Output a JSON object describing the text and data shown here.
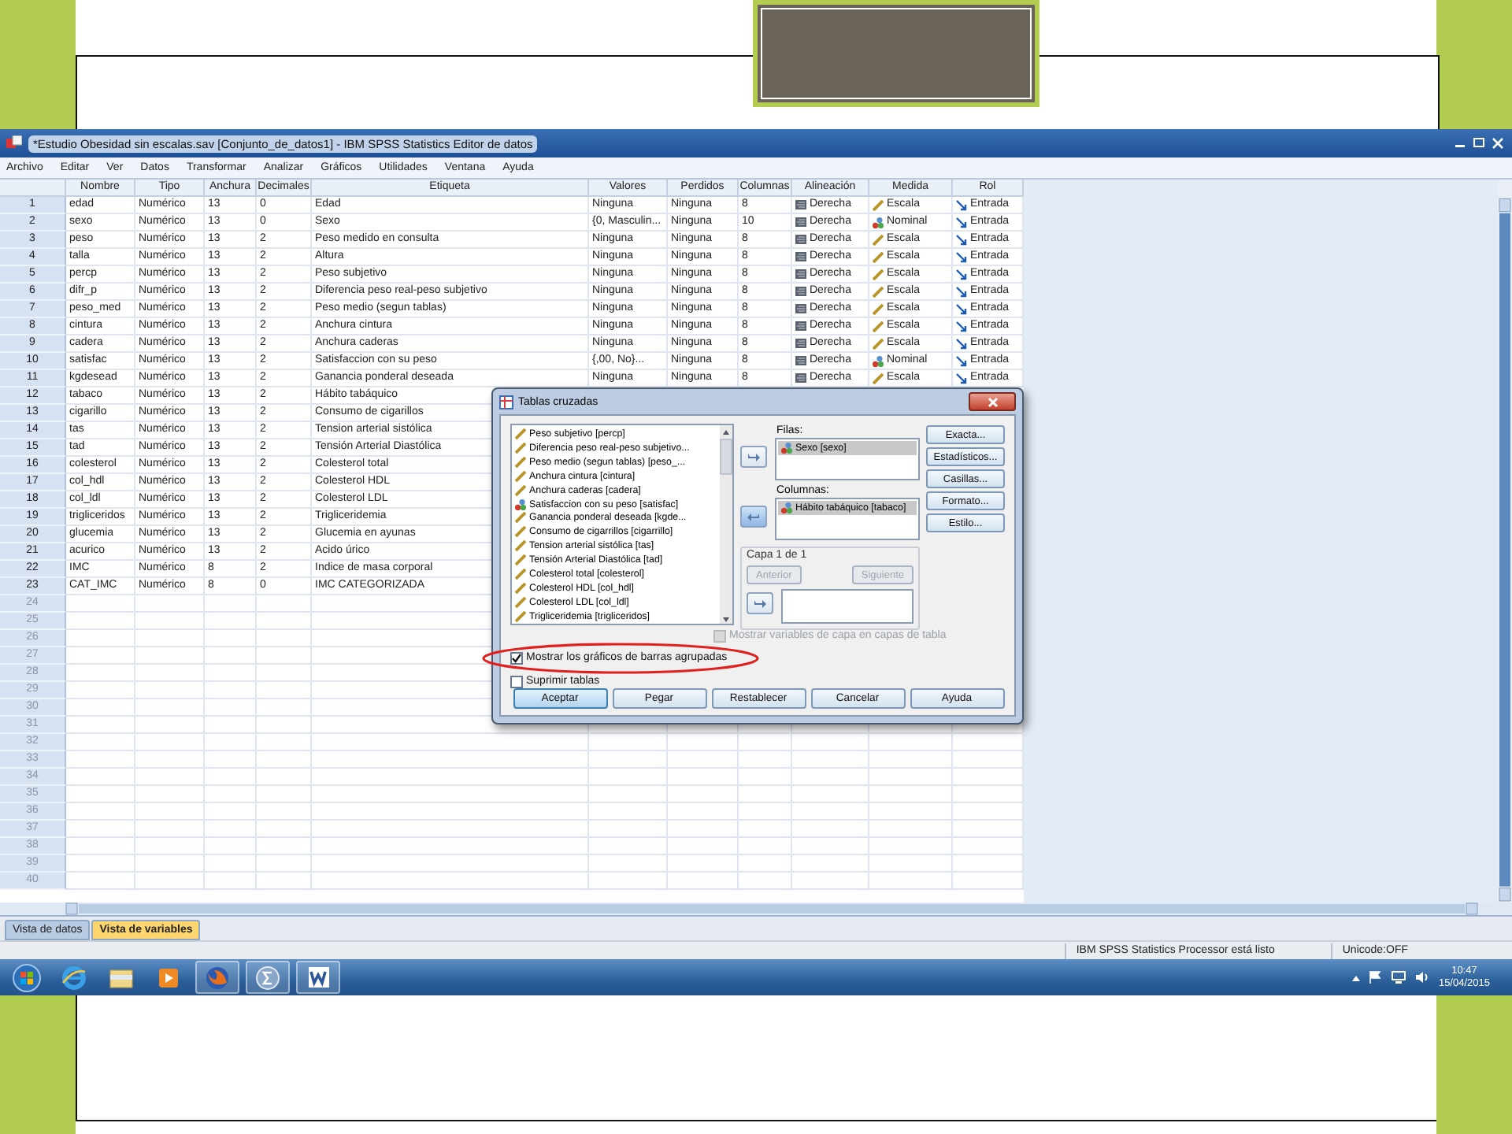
{
  "window": {
    "title": "*Estudio Obesidad sin escalas.sav [Conjunto_de_datos1] - IBM SPSS Statistics Editor de datos"
  },
  "menu": [
    "Archivo",
    "Editar",
    "Ver",
    "Datos",
    "Transformar",
    "Analizar",
    "Gráficos",
    "Utilidades",
    "Ventana",
    "Ayuda"
  ],
  "table": {
    "columns": [
      "Nombre",
      "Tipo",
      "Anchura",
      "Decimales",
      "Etiqueta",
      "Valores",
      "Perdidos",
      "Columnas",
      "Alineación",
      "Medida",
      "Rol"
    ],
    "rows": [
      {
        "number": "1",
        "cells": [
          "edad",
          "Numérico",
          "13",
          "0",
          "Edad",
          "Ninguna",
          "Ninguna",
          "8",
          "Derecha",
          "Escala",
          "Entrada"
        ],
        "kind": "scale"
      },
      {
        "number": "2",
        "cells": [
          "sexo",
          "Numérico",
          "13",
          "0",
          "Sexo",
          "{0, Masculin...",
          "Ninguna",
          "10",
          "Derecha",
          "Nominal",
          "Entrada"
        ],
        "kind": "nominal"
      },
      {
        "number": "3",
        "cells": [
          "peso",
          "Numérico",
          "13",
          "2",
          "Peso medido en consulta",
          "Ninguna",
          "Ninguna",
          "8",
          "Derecha",
          "Escala",
          "Entrada"
        ],
        "kind": "scale"
      },
      {
        "number": "4",
        "cells": [
          "talla",
          "Numérico",
          "13",
          "2",
          "Altura",
          "Ninguna",
          "Ninguna",
          "8",
          "Derecha",
          "Escala",
          "Entrada"
        ],
        "kind": "scale"
      },
      {
        "number": "5",
        "cells": [
          "percp",
          "Numérico",
          "13",
          "2",
          "Peso subjetivo",
          "Ninguna",
          "Ninguna",
          "8",
          "Derecha",
          "Escala",
          "Entrada"
        ],
        "kind": "scale"
      },
      {
        "number": "6",
        "cells": [
          "difr_p",
          "Numérico",
          "13",
          "2",
          "Diferencia peso real-peso subjetivo",
          "Ninguna",
          "Ninguna",
          "8",
          "Derecha",
          "Escala",
          "Entrada"
        ],
        "kind": "scale"
      },
      {
        "number": "7",
        "cells": [
          "peso_med",
          "Numérico",
          "13",
          "2",
          "Peso medio (segun tablas)",
          "Ninguna",
          "Ninguna",
          "8",
          "Derecha",
          "Escala",
          "Entrada"
        ],
        "kind": "scale"
      },
      {
        "number": "8",
        "cells": [
          "cintura",
          "Numérico",
          "13",
          "2",
          "Anchura cintura",
          "Ninguna",
          "Ninguna",
          "8",
          "Derecha",
          "Escala",
          "Entrada"
        ],
        "kind": "scale"
      },
      {
        "number": "9",
        "cells": [
          "cadera",
          "Numérico",
          "13",
          "2",
          "Anchura caderas",
          "Ninguna",
          "Ninguna",
          "8",
          "Derecha",
          "Escala",
          "Entrada"
        ],
        "kind": "scale"
      },
      {
        "number": "10",
        "cells": [
          "satisfac",
          "Numérico",
          "13",
          "2",
          "Satisfaccion con su peso",
          "{,00, No}...",
          "Ninguna",
          "8",
          "Derecha",
          "Nominal",
          "Entrada"
        ],
        "kind": "nominal"
      },
      {
        "number": "11",
        "cells": [
          "kgdesead",
          "Numérico",
          "13",
          "2",
          "Ganancia ponderal deseada",
          "Ninguna",
          "Ninguna",
          "8",
          "Derecha",
          "Escala",
          "Entrada"
        ],
        "kind": "scale"
      },
      {
        "number": "12",
        "cells": [
          "tabaco",
          "Numérico",
          "13",
          "2",
          "Hábito tabáquico"
        ]
      },
      {
        "number": "13",
        "cells": [
          "cigarillo",
          "Numérico",
          "13",
          "2",
          "Consumo de cigarillos"
        ]
      },
      {
        "number": "14",
        "cells": [
          "tas",
          "Numérico",
          "13",
          "2",
          "Tension arterial sistólica"
        ]
      },
      {
        "number": "15",
        "cells": [
          "tad",
          "Numérico",
          "13",
          "2",
          "Tensión Arterial Diastólica"
        ]
      },
      {
        "number": "16",
        "cells": [
          "colesterol",
          "Numérico",
          "13",
          "2",
          "Colesterol total"
        ]
      },
      {
        "number": "17",
        "cells": [
          "col_hdl",
          "Numérico",
          "13",
          "2",
          "Colesterol HDL"
        ]
      },
      {
        "number": "18",
        "cells": [
          "col_ldl",
          "Numérico",
          "13",
          "2",
          "Colesterol LDL"
        ]
      },
      {
        "number": "19",
        "cells": [
          "trigliceridos",
          "Numérico",
          "13",
          "2",
          "Trigliceridemia"
        ]
      },
      {
        "number": "20",
        "cells": [
          "glucemia",
          "Numérico",
          "13",
          "2",
          "Glucemia en ayunas"
        ]
      },
      {
        "number": "21",
        "cells": [
          "acurico",
          "Numérico",
          "13",
          "2",
          "Acido úrico"
        ]
      },
      {
        "number": "22",
        "cells": [
          "IMC",
          "Numérico",
          "8",
          "2",
          "Indice de masa corporal"
        ]
      },
      {
        "number": "23",
        "cells": [
          "CAT_IMC",
          "Numérico",
          "8",
          "0",
          "IMC CATEGORIZADA"
        ]
      },
      {
        "number": "24",
        "cells": []
      },
      {
        "number": "25",
        "cells": []
      },
      {
        "number": "26",
        "cells": []
      },
      {
        "number": "27",
        "cells": []
      },
      {
        "number": "28",
        "cells": []
      },
      {
        "number": "29",
        "cells": []
      },
      {
        "number": "30",
        "cells": []
      },
      {
        "number": "31",
        "cells": []
      },
      {
        "number": "32",
        "cells": []
      },
      {
        "number": "33",
        "cells": []
      },
      {
        "number": "34",
        "cells": []
      },
      {
        "number": "35",
        "cells": []
      },
      {
        "number": "36",
        "cells": []
      },
      {
        "number": "37",
        "cells": []
      },
      {
        "number": "38",
        "cells": []
      },
      {
        "number": "39",
        "cells": []
      },
      {
        "number": "40",
        "cells": []
      }
    ]
  },
  "view_tabs": [
    {
      "label": "Vista de datos",
      "selected": false
    },
    {
      "label": "Vista de variables",
      "selected": true
    }
  ],
  "status_bar": [
    "IBM SPSS Statistics Processor está listo",
    "Unicode:OFF"
  ],
  "dialog": {
    "title": "Tablas cruzadas",
    "variables": [
      {
        "label": "Peso subjetivo [percp]",
        "kind": "scale"
      },
      {
        "label": "Diferencia peso real-peso subjetivo...",
        "kind": "scale"
      },
      {
        "label": "Peso medio (segun tablas) [peso_...",
        "kind": "scale"
      },
      {
        "label": "Anchura cintura [cintura]",
        "kind": "scale"
      },
      {
        "label": "Anchura caderas [cadera]",
        "kind": "scale"
      },
      {
        "label": "Satisfaccion con su peso [satisfac]",
        "kind": "nominal"
      },
      {
        "label": "Ganancia ponderal deseada [kgde...",
        "kind": "scale"
      },
      {
        "label": "Consumo de cigarrillos [cigarrillo]",
        "kind": "scale"
      },
      {
        "label": "Tension arterial sistólica [tas]",
        "kind": "scale"
      },
      {
        "label": "Tensión Arterial Diastólica [tad]",
        "kind": "scale"
      },
      {
        "label": "Colesterol total [colesterol]",
        "kind": "scale"
      },
      {
        "label": "Colesterol HDL [col_hdl]",
        "kind": "scale"
      },
      {
        "label": "Colesterol LDL [col_ldl]",
        "kind": "scale"
      },
      {
        "label": "Trigliceridemia [trigliceridos]",
        "kind": "scale"
      }
    ],
    "rows_label": "Filas:",
    "rows_items": [
      {
        "label": "Sexo [sexo]",
        "kind": "nominal",
        "selected": true
      }
    ],
    "columns_label": "Columnas:",
    "columns_items": [
      {
        "label": "Hábito tabáquico [tabaco]",
        "kind": "nominal",
        "selected": true
      }
    ],
    "layer": {
      "title": "Capa 1 de 1",
      "buttons": [
        {
          "label": "Anterior",
          "disabled": true
        },
        {
          "label": "Siguiente",
          "disabled": true
        }
      ],
      "checkbox": {
        "label": "Mostrar variables de capa en capas de tabla",
        "checked": false,
        "disabled": true
      }
    },
    "side_buttons": [
      "Exacta...",
      "Estadísticos...",
      "Casillas...",
      "Formato...",
      "Estilo..."
    ],
    "options": [
      {
        "label": "Mostrar los gráficos de barras agrupadas",
        "checked": true
      },
      {
        "label": "Suprimir tablas",
        "checked": false
      }
    ],
    "buttons": [
      {
        "label": "Aceptar",
        "default": true
      },
      {
        "label": "Pegar",
        "default": false
      },
      {
        "label": "Restablecer",
        "default": false
      },
      {
        "label": "Cancelar",
        "default": false
      },
      {
        "label": "Ayuda",
        "default": false
      }
    ]
  },
  "taskbar": {
    "time": "10:47",
    "date": "15/04/2015"
  }
}
